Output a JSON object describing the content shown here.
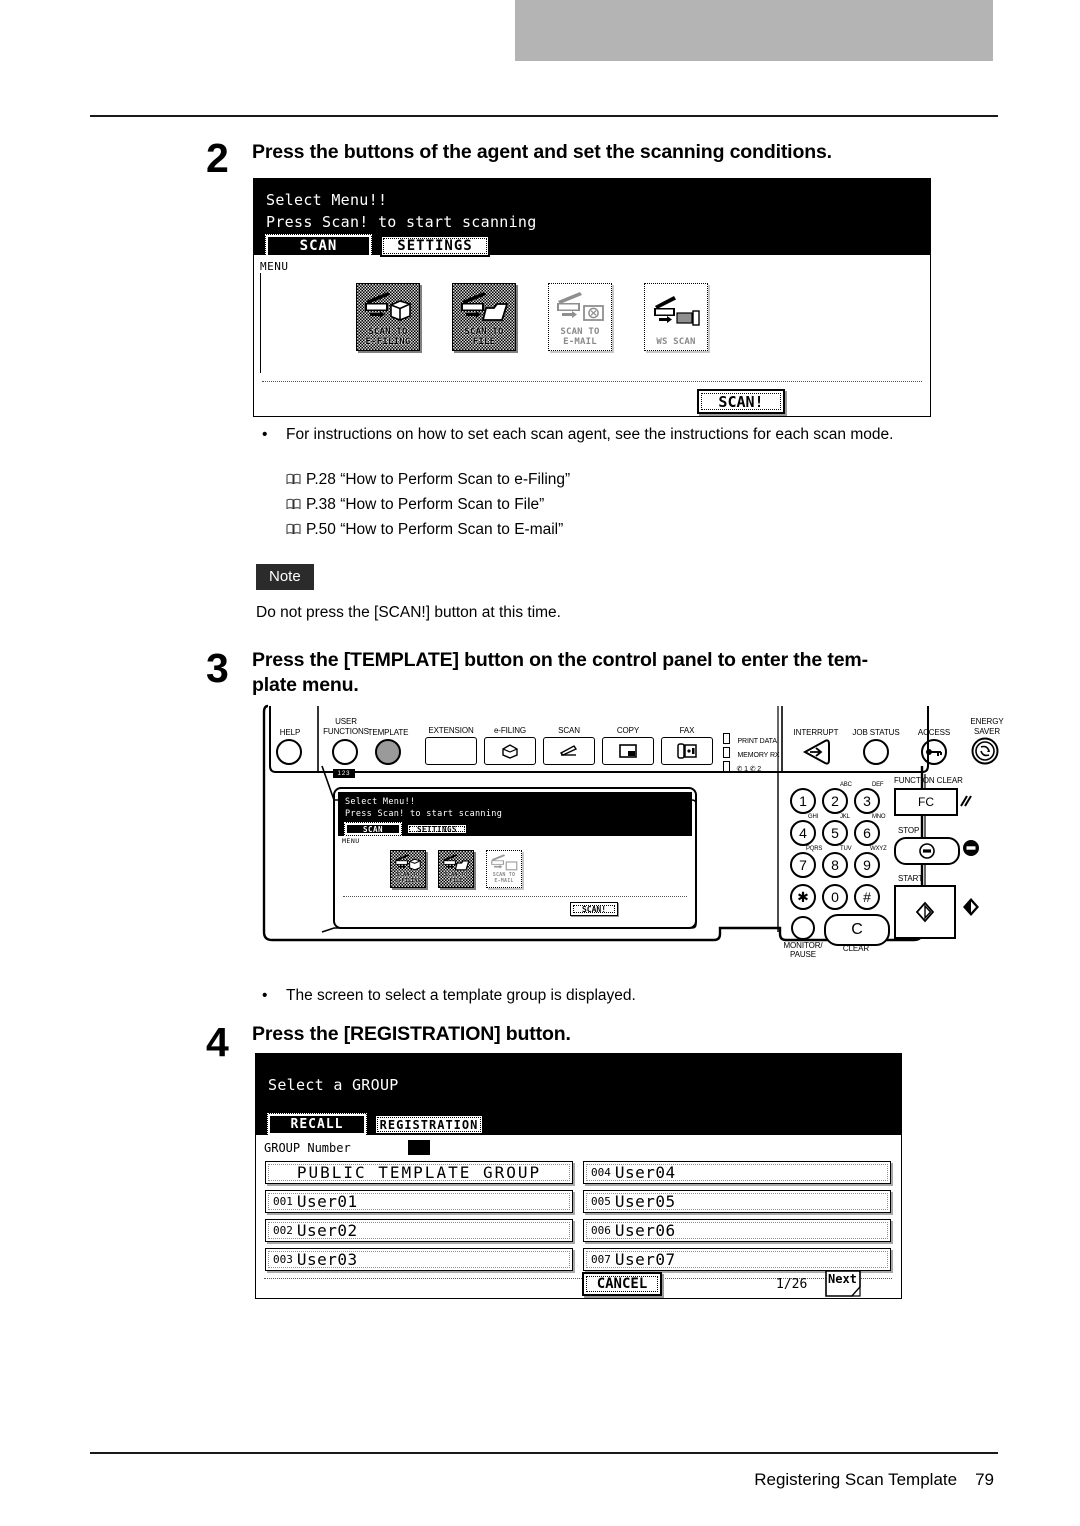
{
  "page": {
    "footer_title": "Registering Scan Template",
    "footer_page": "79"
  },
  "steps": [
    {
      "number": "2",
      "title": "Press the buttons of the agent and set the scanning conditions."
    },
    {
      "number": "3",
      "title": "Press the [TEMPLATE] button on the control panel to enter the tem-\nplate menu."
    },
    {
      "number": "4",
      "title": "Press the [REGISTRATION] button."
    }
  ],
  "bullets": {
    "agent_instructions": "For instructions on how to set each scan agent, see the instructions for each scan mode.",
    "template_group": "The screen to select a template group is displayed."
  },
  "references": [
    {
      "icon": "book-icon",
      "text": "P.28 “How to Perform Scan to e-Filing”"
    },
    {
      "icon": "book-icon",
      "text": "P.38 “How to Perform Scan to File”"
    },
    {
      "icon": "book-icon",
      "text": "P.50 “How to Perform Scan to E-mail”"
    }
  ],
  "note": {
    "label": "Note",
    "text": "Do not press the [SCAN!] button at this time."
  },
  "scan_menu_screen": {
    "line1": "Select Menu!!",
    "line2": "Press Scan! to start scanning",
    "tabs": [
      {
        "label": "SCAN",
        "selected": true
      },
      {
        "label": "SETTINGS",
        "selected": false
      }
    ],
    "menu_label": "MENU",
    "agents": [
      {
        "caption": "SCAN TO\nE-FILING",
        "icon": "scan-to-efiling-icon",
        "enabled": true
      },
      {
        "caption": "SCAN TO\nFILE",
        "icon": "scan-to-file-icon",
        "enabled": true
      },
      {
        "caption": "SCAN TO\nE-MAIL",
        "icon": "scan-to-email-icon",
        "enabled": false
      },
      {
        "caption": "WS SCAN",
        "icon": "ws-scan-icon",
        "enabled": false
      }
    ],
    "scan_button": "SCAN!"
  },
  "control_panel": {
    "top_buttons": [
      {
        "label": "HELP",
        "type": "circle"
      },
      {
        "label": "USER\nFUNCTIONS",
        "type": "circle"
      },
      {
        "label": "TEMPLATE",
        "type": "circle-dark"
      },
      {
        "label": "EXTENSION",
        "type": "square-blank"
      },
      {
        "label": "e-FILING",
        "type": "square",
        "icon": "efiling-box-icon"
      },
      {
        "label": "SCAN",
        "type": "square",
        "icon": "scanner-icon"
      },
      {
        "label": "COPY",
        "type": "square",
        "icon": "copy-page-icon"
      },
      {
        "label": "FAX",
        "type": "square",
        "icon": "fax-icon"
      }
    ],
    "indicators": [
      "PRINT DATA",
      "MEMORY RX",
      "✆ 1   ✆ 2"
    ],
    "right_buttons": [
      {
        "label": "INTERRUPT",
        "icon": "interrupt-icon"
      },
      {
        "label": "JOB STATUS",
        "icon": "job-status-icon"
      },
      {
        "label": "ACCESS",
        "icon": "access-key-icon"
      },
      {
        "label": "ENERGY\nSAVER",
        "icon": "energy-saver-icon"
      }
    ],
    "numeric_label": "123",
    "keypad": [
      {
        "digit": "1",
        "letters": ""
      },
      {
        "digit": "2",
        "letters": "ABC"
      },
      {
        "digit": "3",
        "letters": "DEF"
      },
      {
        "digit": "4",
        "letters": "GHI"
      },
      {
        "digit": "5",
        "letters": "JKL"
      },
      {
        "digit": "6",
        "letters": "MNO"
      },
      {
        "digit": "7",
        "letters": "PQRS"
      },
      {
        "digit": "8",
        "letters": "TUV"
      },
      {
        "digit": "9",
        "letters": "WXYZ"
      },
      {
        "digit": "✱",
        "letters": ""
      },
      {
        "digit": "0",
        "letters": ""
      },
      {
        "digit": "#",
        "letters": ""
      }
    ],
    "monitor_pause": "MONITOR/\nPAUSE",
    "clear_label": "CLEAR",
    "clear_key": "C",
    "function_clear": "FUNCTION CLEAR",
    "fc_label": "FC",
    "stop_label": "STOP",
    "start_label": "START",
    "mini_screen": {
      "line1": "Select Menu!!",
      "line2": "Press Scan! to start scanning",
      "tabs": [
        {
          "label": "SCAN",
          "selected": true
        },
        {
          "label": "SETTINGS",
          "selected": false
        }
      ],
      "menu_label": "MENU",
      "agents": [
        {
          "caption": "SCAN TO\nE-FILING",
          "enabled": true
        },
        {
          "caption": "SCAN TO\nFILE",
          "enabled": true
        },
        {
          "caption": "SCAN TO\nE-MAIL",
          "enabled": false
        }
      ],
      "scan_button": "SCAN!"
    }
  },
  "group_screen": {
    "title": "Select a GROUP",
    "tabs": [
      {
        "label": "RECALL",
        "selected": true
      },
      {
        "label": "REGISTRATION",
        "selected": false
      }
    ],
    "group_number_label": "GROUP Number",
    "group_number_value": "",
    "left_column": [
      {
        "number": "",
        "name": "PUBLIC TEMPLATE GROUP",
        "public": true
      },
      {
        "number": "001",
        "name": "User01",
        "public": false
      },
      {
        "number": "002",
        "name": "User02",
        "public": false
      },
      {
        "number": "003",
        "name": "User03",
        "public": false
      }
    ],
    "right_column": [
      {
        "number": "004",
        "name": "User04",
        "public": false
      },
      {
        "number": "005",
        "name": "User05",
        "public": false
      },
      {
        "number": "006",
        "name": "User06",
        "public": false
      },
      {
        "number": "007",
        "name": "User07",
        "public": false
      }
    ],
    "cancel_button": "CANCEL",
    "page_indicator": "1/26",
    "next_button": "Next"
  },
  "colors": {
    "topbar": "#b4b4b4",
    "note_bg": "#2b2b2b",
    "lcd_header": "#000000",
    "disabled_text": "#8a8a8a"
  }
}
